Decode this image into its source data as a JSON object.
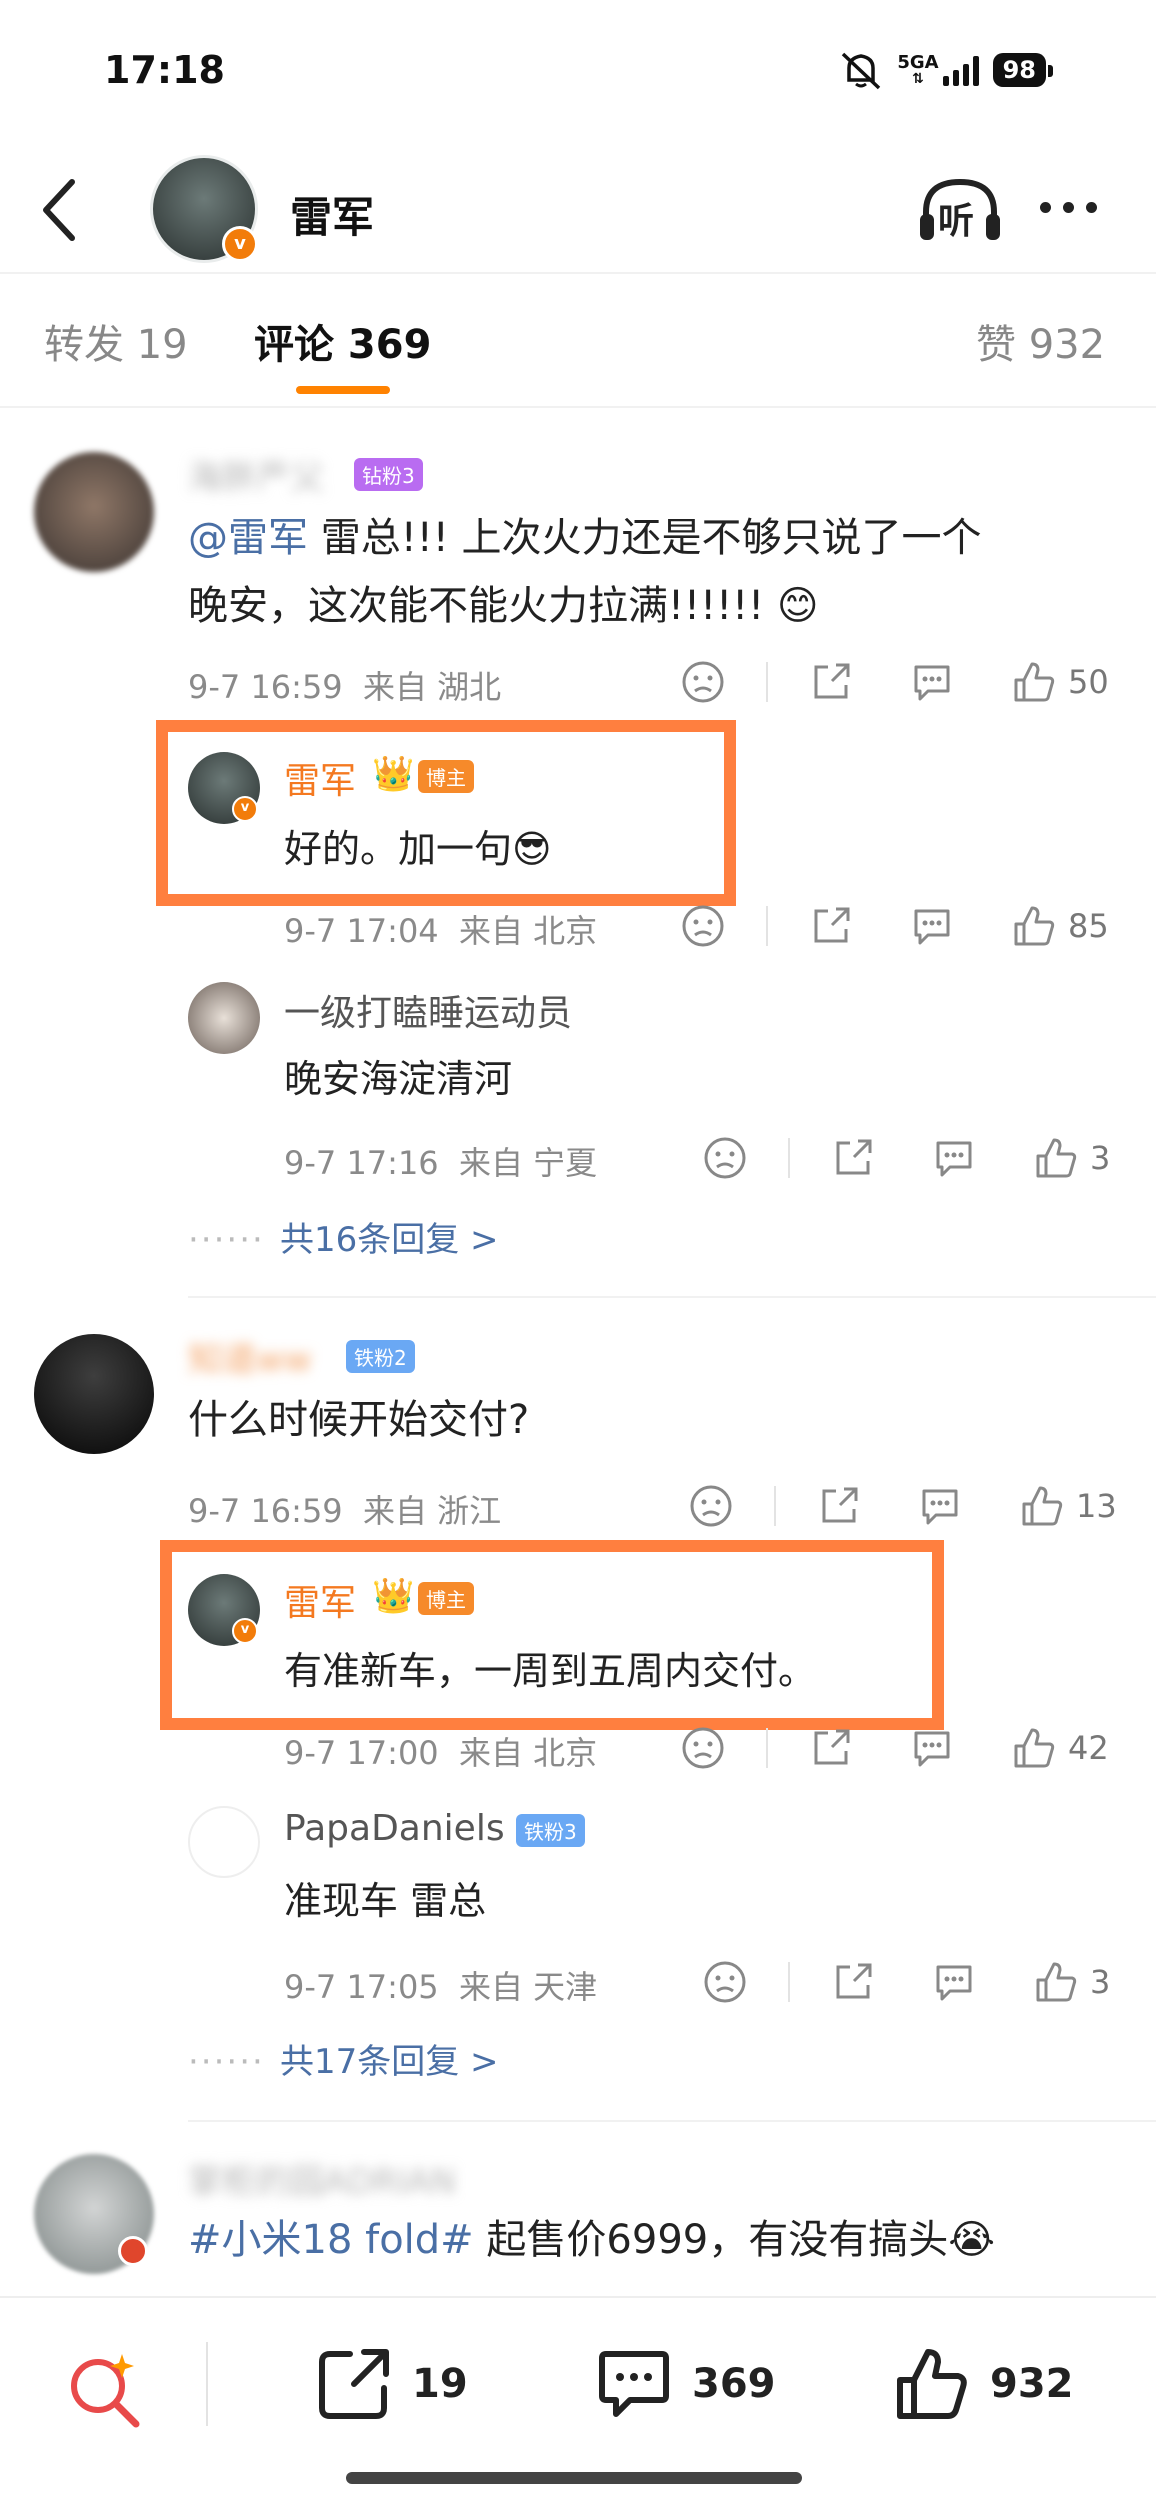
{
  "status": {
    "time": "17:18",
    "network": "5GA",
    "battery": "98"
  },
  "header": {
    "title": "雷军",
    "listen_label": "听"
  },
  "tabs": {
    "reposts": "转发 19",
    "comments": "评论 369",
    "likes": "赞 932"
  },
  "comments": [
    {
      "username": "海胖严父",
      "badge": "钻粉3",
      "mention": "@雷军",
      "text_line1": " 雷总!!! 上次火力还是不够只说了一个",
      "text_line2": "晚安，这次能不能火力拉满!!!!!! 😊",
      "time": "9-7 16:59",
      "location": "来自 湖北",
      "likes": "50",
      "replies": [
        {
          "username": "雷军",
          "badge": "博主",
          "text": "好的。加一句😎",
          "time": "9-7 17:04",
          "location": "来自 北京",
          "likes": "85"
        },
        {
          "username": "一级打瞌睡运动员",
          "text": "晚安海淀清河",
          "time": "9-7 17:16",
          "location": "来自 宁夏",
          "likes": "3"
        }
      ],
      "more_replies": "共16条回复 >"
    },
    {
      "username": "知道ww",
      "badge": "铁粉2",
      "text": "什么时候开始交付?",
      "time": "9-7 16:59",
      "location": "来自 浙江",
      "likes": "13",
      "replies": [
        {
          "username": "雷军",
          "badge": "博主",
          "text": "有准新车，一周到五周内交付。",
          "time": "9-7 17:00",
          "location": "来自 北京",
          "likes": "42"
        },
        {
          "username": "PapaDaniels",
          "badge": "铁粉3",
          "text": "准现车 雷总",
          "time": "9-7 17:05",
          "location": "来自 天津",
          "likes": "3"
        }
      ],
      "more_replies": "共17条回复 >"
    },
    {
      "username": "掌柜的园ADRIAN",
      "hashtag": "#小米18 fold#",
      "text": " 起售价6999，有没有搞头😭"
    }
  ],
  "bottom": {
    "reposts": "19",
    "comments": "369",
    "likes": "932"
  },
  "colors": {
    "accent": "#ff8200",
    "link": "#4a6fa5",
    "highlight": "#ff7f3f",
    "blogger": "#f47920"
  }
}
